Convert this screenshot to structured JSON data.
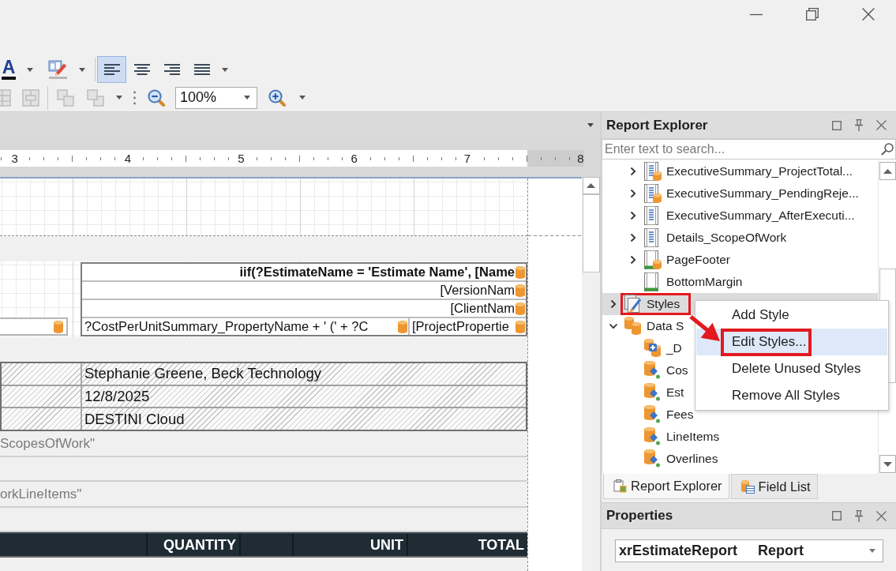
{
  "toolbar": {
    "font_color": {
      "glyph": "A"
    },
    "alignment": [
      {
        "kind": "left",
        "selected": true
      },
      {
        "kind": "center",
        "selected": false
      },
      {
        "kind": "right",
        "selected": false
      },
      {
        "kind": "justify",
        "selected": false
      }
    ],
    "arrange_buttons": [
      {
        "kind": "cells",
        "disabled": true
      },
      {
        "kind": "merge",
        "disabled": true
      },
      {
        "kind": "front",
        "disabled": true
      },
      {
        "kind": "back",
        "disabled": true
      }
    ],
    "zoom": {
      "value": "100%"
    }
  },
  "designer": {
    "ruler": [
      "3",
      "4",
      "5",
      "6",
      "7",
      "8"
    ],
    "header_table": {
      "rows": [
        [
          {
            "text": "iif(?EstimateName = 'Estimate Name', [Name",
            "bold": true,
            "right_aligned": true,
            "bound": true
          }
        ],
        [
          {
            "text": "[VersionNam",
            "bold": false,
            "right_aligned": true,
            "bound": true
          }
        ],
        [
          {
            "text": "[ClientNam",
            "bold": false,
            "right_aligned": true,
            "bound": true
          }
        ],
        [
          {
            "text": "?CostPerUnitSummary_PropertyName + ' (' + ?C",
            "bold": false,
            "right_aligned": false,
            "bound": true
          },
          {
            "text": "[ProjectPropertie",
            "bold": false,
            "right_aligned": false,
            "bound": true
          }
        ]
      ]
    },
    "side_field": {
      "bound": true
    },
    "info_rows": [
      "Stephanie Greene, Beck Technology",
      "12/8/2025",
      "DESTINI Cloud"
    ],
    "collapsed_bands": [
      {
        "caption": "ScopesOfWork\""
      },
      {
        "caption": "orkLineItems\""
      }
    ],
    "table_header": [
      "QUANTITY",
      "UNIT",
      "TOTAL"
    ]
  },
  "report_explorer": {
    "title": "Report Explorer",
    "search": {
      "placeholder": "Enter text to search..."
    },
    "tree": {
      "continued": [
        {
          "label": "ExecutiveSummary_ProjectTotal...",
          "kind": "band-data",
          "expandable": true,
          "expanded": false,
          "selected": false,
          "callout": false
        },
        {
          "label": "ExecutiveSummary_PendingReje...",
          "kind": "band-data",
          "expandable": true,
          "expanded": false,
          "selected": false,
          "callout": false
        },
        {
          "label": "ExecutiveSummary_AfterExecuti...",
          "kind": "band",
          "expandable": true,
          "expanded": false,
          "selected": false,
          "callout": false
        },
        {
          "label": "Details_ScopeOfWork",
          "kind": "band",
          "expandable": true,
          "expanded": false,
          "selected": false,
          "callout": false
        },
        {
          "label": "PageFooter",
          "kind": "footer-data",
          "expandable": true,
          "expanded": false,
          "selected": false,
          "callout": false
        },
        {
          "label": "BottomMargin",
          "kind": "margin",
          "expandable": false,
          "selected": false,
          "callout": false
        }
      ],
      "items": [
        {
          "label": "Styles",
          "kind": "styles",
          "expandable": true,
          "expanded": false,
          "selected": true,
          "callout": true
        },
        {
          "label": "Data S",
          "kind": "datasource",
          "expandable": true,
          "expanded": true,
          "selected": false,
          "callout": false,
          "children": [
            {
              "label": "_D",
              "kind": "calc-field",
              "expandable": false,
              "selected": false,
              "callout": false
            },
            {
              "label": "Cos",
              "kind": "query",
              "expandable": false,
              "selected": false,
              "callout": false
            },
            {
              "label": "Est",
              "kind": "query",
              "expandable": false,
              "selected": false,
              "callout": false
            },
            {
              "label": "Fees",
              "kind": "query",
              "expandable": false,
              "selected": false,
              "callout": false
            },
            {
              "label": "LineItems",
              "kind": "query",
              "expandable": false,
              "selected": false,
              "callout": false
            },
            {
              "label": "Overlines",
              "kind": "query",
              "expandable": false,
              "selected": false,
              "callout": false
            }
          ]
        }
      ]
    },
    "context_menu": {
      "items": [
        {
          "label": "Add Style",
          "selected": false,
          "callout": false
        },
        {
          "label": "Edit Styles...",
          "selected": true,
          "callout": true
        },
        {
          "label": "Delete Unused Styles",
          "selected": false,
          "callout": false
        },
        {
          "label": "Remove All Styles",
          "selected": false,
          "callout": false
        }
      ]
    },
    "tabs": [
      {
        "label": "Report Explorer",
        "selected": true
      },
      {
        "label": "Field List",
        "selected": false
      }
    ]
  },
  "properties": {
    "title": "Properties",
    "selector": {
      "name": "xrEstimateReport",
      "type": "Report"
    }
  }
}
